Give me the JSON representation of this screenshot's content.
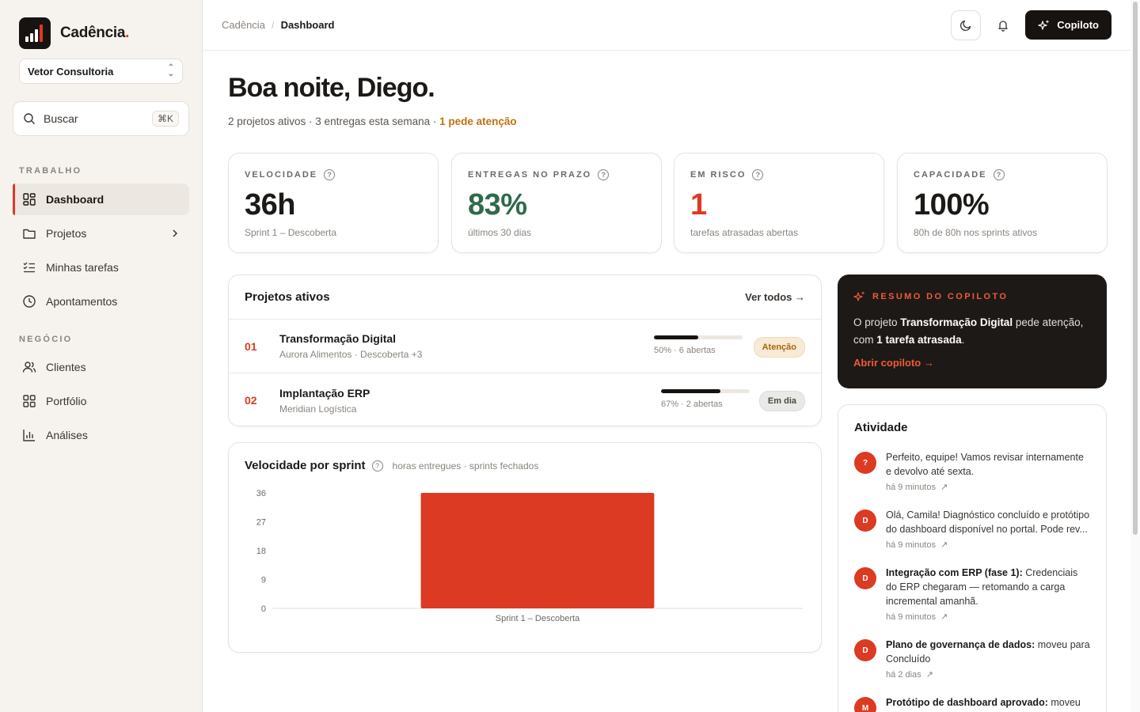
{
  "brand": {
    "name": "Cadência",
    "dot": "."
  },
  "org": {
    "name": "Vetor Consultoria"
  },
  "search": {
    "label": "Buscar",
    "shortcut": "⌘K"
  },
  "sidebar": {
    "section_work": "TRABALHO",
    "section_business": "NEGÓCIO",
    "items": [
      {
        "label": "Dashboard",
        "icon": "grid-icon"
      },
      {
        "label": "Projetos",
        "icon": "folder-icon"
      },
      {
        "label": "Minhas tarefas",
        "icon": "checklist-icon"
      },
      {
        "label": "Apontamentos",
        "icon": "clock-icon"
      },
      {
        "label": "Clientes",
        "icon": "users-icon"
      },
      {
        "label": "Portfólio",
        "icon": "grid-icon"
      },
      {
        "label": "Análises",
        "icon": "bar-chart-icon"
      }
    ]
  },
  "breadcrumb": {
    "root": "Cadência",
    "separator": "/",
    "current": "Dashboard"
  },
  "topbar": {
    "copilot_label": "Copiloto"
  },
  "greeting": {
    "title": "Boa noite, Diego.",
    "summary": "2 projetos ativos · 3 entregas esta semana · ",
    "attention": "1 pede atenção"
  },
  "stats": [
    {
      "label": "VELOCIDADE",
      "value": "36h",
      "caption": "Sprint 1 – Descoberta"
    },
    {
      "label": "ENTREGAS NO PRAZO",
      "value": "83%",
      "caption": "últimos 30 dias"
    },
    {
      "label": "EM RISCO",
      "value": "1",
      "caption": "tarefas atrasadas abertas"
    },
    {
      "label": "CAPACIDADE",
      "value": "100%",
      "caption": "80h de 80h nos sprints ativos"
    }
  ],
  "projects": {
    "title": "Projetos ativos",
    "see_all": "Ver todos →",
    "rows": [
      {
        "num": "01",
        "name": "Transformação Digital",
        "sub": "Aurora Alimentos · Descoberta +3",
        "progress": 0.5,
        "progress_text": "50% · 6 abertas",
        "badge": "Atenção"
      },
      {
        "num": "02",
        "name": "Implantação ERP",
        "sub": "Meridian Logística",
        "progress": 0.67,
        "progress_text": "67% · 2 abertas",
        "badge": "Em dia"
      }
    ]
  },
  "velocity": {
    "title": "Velocidade por sprint",
    "note": "horas entregues · sprints fechados"
  },
  "chart_data": {
    "type": "bar",
    "categories": [
      "Sprint 1 – Descoberta"
    ],
    "values": [
      36
    ],
    "title": "Velocidade por sprint",
    "subtitle": "horas entregues · sprints fechados",
    "xlabel": "",
    "ylabel": "",
    "ylim": [
      0,
      36
    ],
    "yticks": [
      0,
      9,
      18,
      27,
      36
    ],
    "grid": false,
    "bar_color": "#dc3a22"
  },
  "copilot": {
    "label": "RESUMO DO COPILOTO",
    "text_a": "O projeto ",
    "text_b": "Transformação Digital",
    "text_c": " pede atenção, com ",
    "text_d": "1 tarefa atrasada",
    "text_e": ".",
    "link": "Abrir copiloto →"
  },
  "activity": {
    "title": "Atividade",
    "items": [
      {
        "avatar": "?",
        "bold": "",
        "text": "Perfeito, equipe! Vamos revisar internamente e devolvo até sexta.",
        "time": "há 9 minutos"
      },
      {
        "avatar": "D",
        "bold": "",
        "text": "Olá, Camila! Diagnóstico concluído e protótipo do dashboard disponível no portal. Pode rev...",
        "time": "há 9 minutos"
      },
      {
        "avatar": "D",
        "bold": "Integração com ERP (fase 1):",
        "text": " Credenciais do ERP chegaram — retomando a carga incremental amanhã.",
        "time": "há 9 minutos"
      },
      {
        "avatar": "D",
        "bold": "Plano de governança de dados:",
        "text": " moveu para Concluído",
        "time": "há 2 dias"
      },
      {
        "avatar": "M",
        "bold": "Protótipo de dashboard aprovado:",
        "text": " moveu",
        "time": ""
      }
    ]
  },
  "colors": {
    "accent": "#dc3a22",
    "attention": "#c2700f",
    "success": "#2e6b4a",
    "dark": "#171311"
  }
}
